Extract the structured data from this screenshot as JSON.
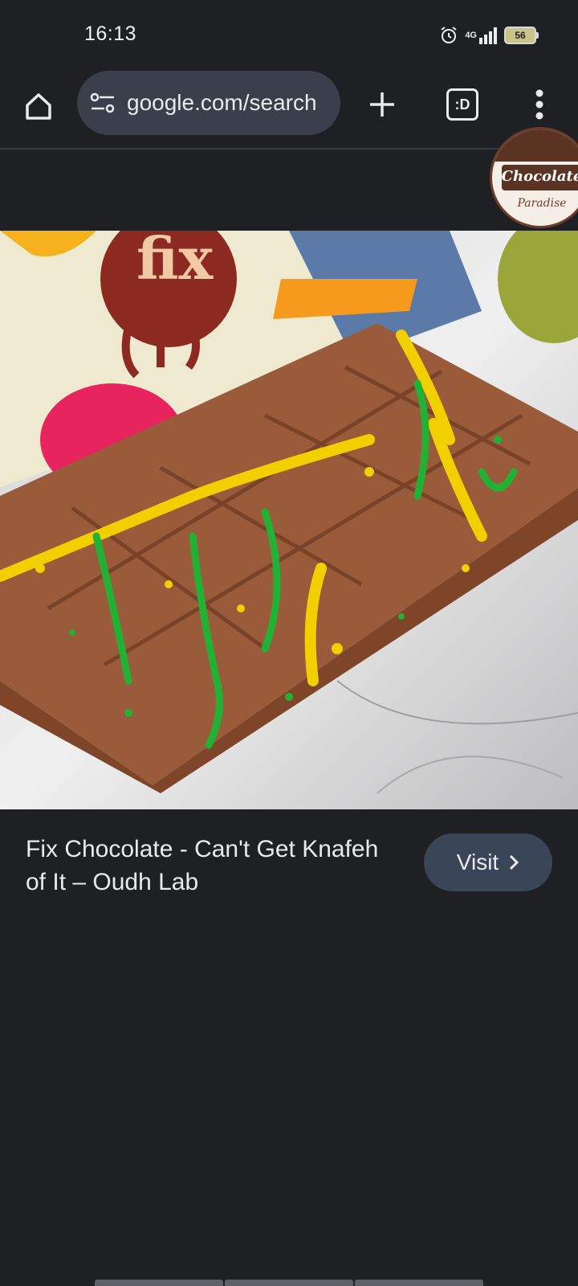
{
  "status_bar": {
    "time": "16:13",
    "network": "4G",
    "battery": "56",
    "icons": [
      "alarm-icon",
      "signal-icon",
      "battery-icon"
    ]
  },
  "toolbar": {
    "url": "google.com/search",
    "tab_switcher_label": ":D",
    "icons": [
      "home-icon",
      "site-info-icon",
      "plus-icon",
      "tab-switcher-icon",
      "more-vert-icon"
    ]
  },
  "brand_logo": {
    "word": "Chocolate",
    "sub": "Paradise"
  },
  "photo": {
    "package_brand": "fix",
    "colors": {
      "chocolate": "#9a5b3a",
      "yellow_splatter": "#f2d000",
      "green_splatter": "#22b135",
      "marble": "#e6e6e6"
    }
  },
  "result": {
    "title": "Fix Chocolate - Can't Get Knafeh of It – Oudh Lab",
    "visit_label": "Visit"
  },
  "colors": {
    "background": "#1f2024",
    "url_bar": "#3a3f4b",
    "visit_button": "#3b4558",
    "text": "#e8eaed"
  }
}
